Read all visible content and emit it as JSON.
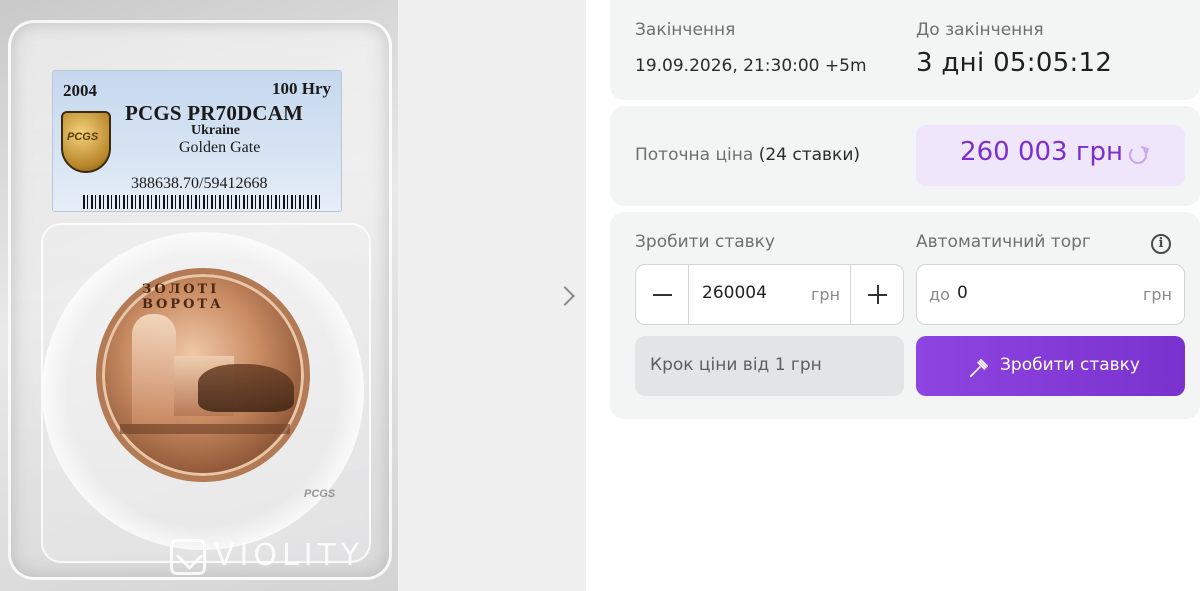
{
  "gallery": {
    "slab_label": {
      "year": "2004",
      "denomination": "100 Hry",
      "grade": "PCGS PR70DCAM",
      "country": "Ukraine",
      "coin_name": "Golden Gate",
      "cert_number": "388638.70/59412668"
    },
    "coin_legend": "ЗОЛОТІ ВОРОТА",
    "slab_mark": "PCGS",
    "watermark": "VIOLITY",
    "shield_text": "PCGS"
  },
  "auction": {
    "end_label": "Закінчення",
    "end_value": "19.09.2026, 21:30:00 +5m",
    "time_left_label": "До закінчення",
    "time_left_value": "3 дні 05:05:12"
  },
  "price": {
    "label": "Поточна ціна",
    "bids_count": "(24 ставки)",
    "value": "260 003 грн",
    "accent_color": "#7a2fd0"
  },
  "bid": {
    "label": "Зробити ставку",
    "amount": "260004",
    "unit": "грн",
    "step_info": "Крок ціни від 1 грн",
    "button_label": "Зробити ставку",
    "button_color": "#8e44e0"
  },
  "auto_bid": {
    "label": "Автоматичний торг",
    "prefix": "до",
    "value": "0",
    "unit": "грн",
    "info_icon": "i"
  }
}
